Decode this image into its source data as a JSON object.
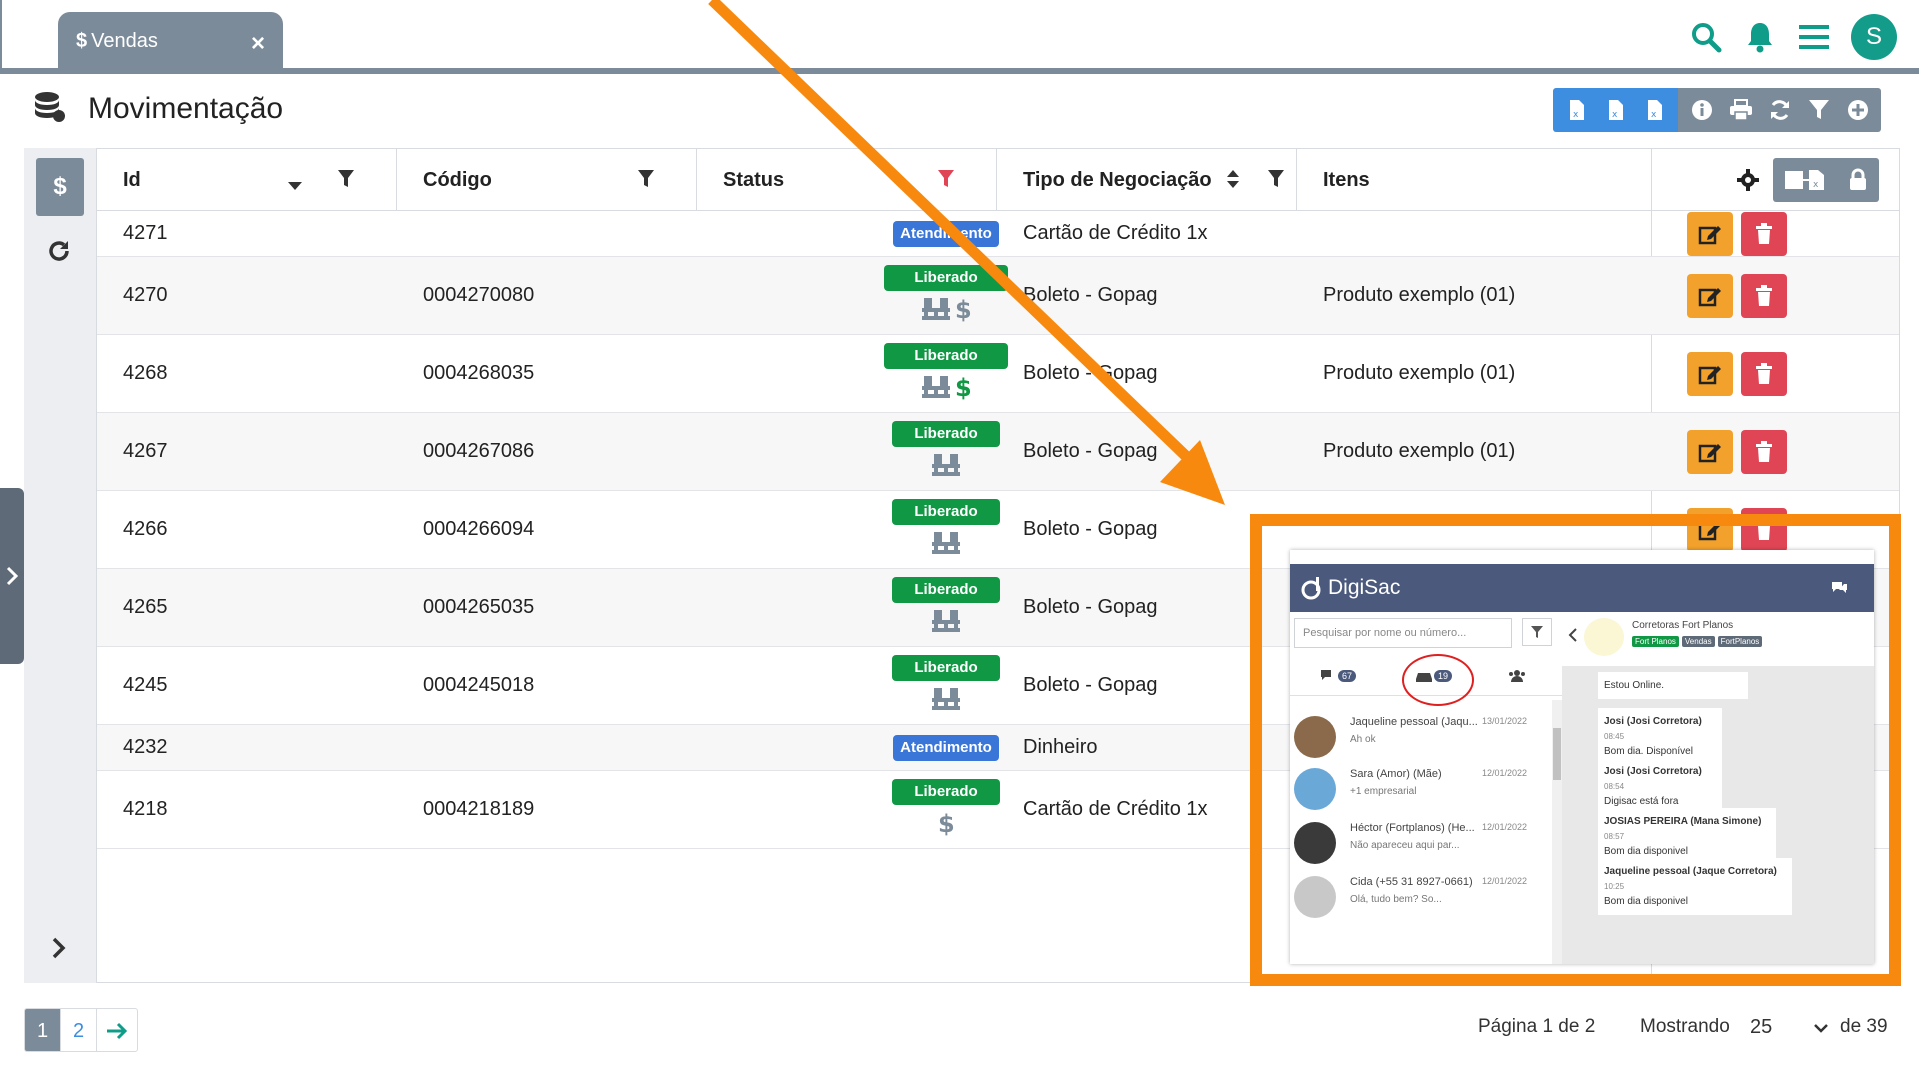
{
  "tab": {
    "label": "Vendas",
    "close": "×"
  },
  "user": {
    "initial": "S"
  },
  "page": {
    "title": "Movimentação"
  },
  "columns": {
    "id": "Id",
    "codigo": "Código",
    "status": "Status",
    "tipo": "Tipo de Negociação",
    "itens": "Itens"
  },
  "rows": [
    {
      "id": "4271",
      "codigo": "",
      "status": "Atendimento",
      "tipo": "Cartão de Crédito 1x",
      "itens": ""
    },
    {
      "id": "4270",
      "codigo": "0004270080",
      "status": "Liberado",
      "tipo": "Boleto - Gopag",
      "itens": "Produto exemplo (01)"
    },
    {
      "id": "4268",
      "codigo": "0004268035",
      "status": "Liberado",
      "tipo": "Boleto - Gopag",
      "itens": "Produto exemplo (01)"
    },
    {
      "id": "4267",
      "codigo": "0004267086",
      "status": "Liberado",
      "tipo": "Boleto - Gopag",
      "itens": "Produto exemplo (01)"
    },
    {
      "id": "4266",
      "codigo": "0004266094",
      "status": "Liberado",
      "tipo": "Boleto - Gopag",
      "itens": ""
    },
    {
      "id": "4265",
      "codigo": "0004265035",
      "status": "Liberado",
      "tipo": "Boleto - Gopag",
      "itens": ""
    },
    {
      "id": "4245",
      "codigo": "0004245018",
      "status": "Liberado",
      "tipo": "Boleto - Gopag",
      "itens": ""
    },
    {
      "id": "4232",
      "codigo": "",
      "status": "Atendimento",
      "tipo": "Dinheiro",
      "itens": ""
    },
    {
      "id": "4218",
      "codigo": "0004218189",
      "status": "Liberado",
      "tipo": "Cartão de Crédito 1x",
      "itens": ""
    }
  ],
  "pagination": {
    "pages": [
      "1",
      "2"
    ],
    "next": "→",
    "page_info": "Página 1 de 2",
    "showing_label": "Mostrando",
    "per_page": "25",
    "total": "de 39"
  },
  "colors": {
    "accent": "#0f9d8a",
    "blue": "#3d8de0",
    "gray": "#7c8b99",
    "orange": "#f7890e",
    "green": "#119844"
  },
  "digisac": {
    "brand": "DigiSac",
    "search_placeholder": "Pesquisar por nome ou número...",
    "tab_counts": [
      "67",
      "19"
    ],
    "contact_name": "Corretoras Fort Planos",
    "contact_tags": [
      "Fort Planos",
      "Vendas",
      "FortPlanos"
    ],
    "chats": [
      {
        "name": "Jaqueline pessoal (Jaqu...",
        "date": "13/01/2022",
        "msg": "Ah ok"
      },
      {
        "name": "Sara (Amor) (Mãe)",
        "date": "12/01/2022",
        "msg": "+1 empresarial"
      },
      {
        "name": "Héctor (Fortplanos) (He...",
        "date": "12/01/2022",
        "msg": "Não apareceu aqui par..."
      },
      {
        "name": "Cida (+55 31 8927-0661)",
        "date": "12/01/2022",
        "msg": "Olá, tudo bem? So..."
      }
    ],
    "messages": [
      {
        "author": "",
        "time": "",
        "text": "Estou Online."
      },
      {
        "author": "Josi (Josi Corretora)",
        "time": "08:45",
        "text": "Bom dia. Disponível"
      },
      {
        "author": "Josi (Josi Corretora)",
        "time": "08:54",
        "text": "Digisac está fora"
      },
      {
        "author": "JOSIAS PEREIRA (Mana Simone)",
        "time": "08:57",
        "text": "Bom dia disponivel"
      },
      {
        "author": "Jaqueline pessoal (Jaque Corretora)",
        "time": "10:25",
        "text": "Bom dia disponivel"
      }
    ]
  }
}
